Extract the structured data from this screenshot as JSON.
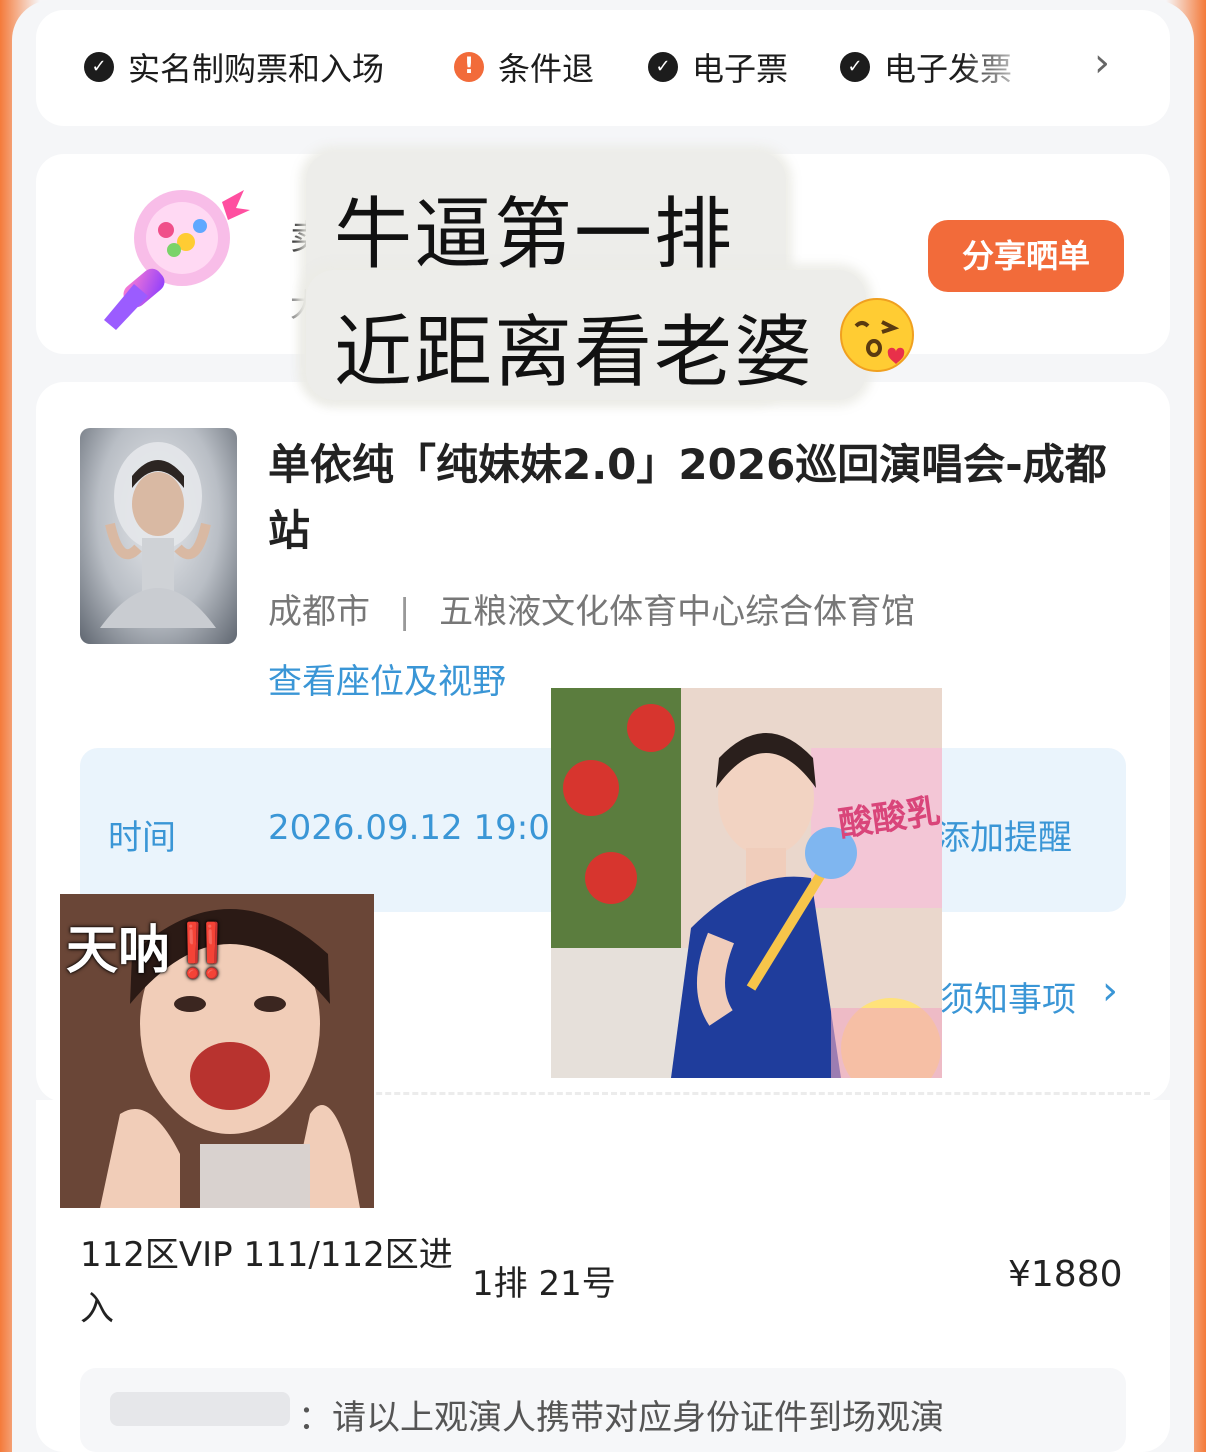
{
  "policy": {
    "items": [
      {
        "label": "实名制购票和入场",
        "icon": "check-icon"
      },
      {
        "label": "条件退",
        "icon": "warning-icon"
      },
      {
        "label": "电子票",
        "icon": "check-icon"
      },
      {
        "label": "电子发票",
        "icon": "check-icon"
      }
    ],
    "more_icon": "chevron-right-icon"
  },
  "share": {
    "button_label": "分享晒单",
    "hidden_line_1": "卖",
    "hidden_line_2": "大"
  },
  "caption": {
    "line1": "牛逼第一排",
    "line2": "近距离看老婆"
  },
  "event": {
    "title": "单依纯「纯妹妹2.0」2026巡回演唱会-成都站",
    "city": "成都市",
    "separator": "|",
    "venue": "五粮液文化体育中心综合体育馆",
    "seat_link": "查看座位及视野",
    "time_label": "时间",
    "time_value": "2026.09.12 19:0",
    "reminder": "添加提醒",
    "notice": "须知事项"
  },
  "ticket": {
    "zone": "112区VIP 111/112区进入",
    "seat": "1排 21号",
    "price": "¥1880",
    "tip": "：请以上观演人携带对应身份证件到场观演"
  },
  "meme": {
    "text": "天呐",
    "bang": "‼️",
    "yogurt": "酸酸乳"
  },
  "colors": {
    "accent_orange": "#f26b3a",
    "link_blue": "#3a96d6"
  }
}
